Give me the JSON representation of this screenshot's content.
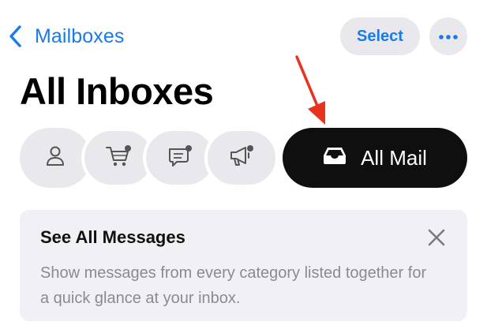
{
  "nav": {
    "back_label": "Mailboxes"
  },
  "toolbar": {
    "select_label": "Select"
  },
  "header": {
    "title": "All Inboxes"
  },
  "categories": [
    {
      "icon": "person-icon",
      "name": "Primary",
      "badge": false
    },
    {
      "icon": "shopping-cart-icon",
      "name": "Transactions",
      "badge": true
    },
    {
      "icon": "message-bubble-icon",
      "name": "Updates",
      "badge": true
    },
    {
      "icon": "megaphone-icon",
      "name": "Promotions",
      "badge": true
    }
  ],
  "all_mail": {
    "label": "All Mail",
    "icon": "tray-icon"
  },
  "tip": {
    "title": "See All Messages",
    "body": "Show messages from every category listed together for a quick glance at your inbox."
  },
  "colors": {
    "accent": "#1a7ae8",
    "pill_bg": "#e8e8ed",
    "selected_bg": "#0f0f0f",
    "annotation_arrow": "#e8321e",
    "card_bg": "#f0f0f5",
    "secondary_text": "#8a8a8f"
  }
}
